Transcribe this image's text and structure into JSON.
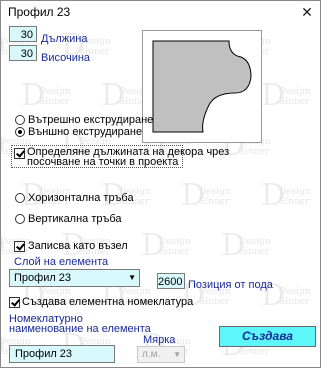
{
  "window": {
    "title": "Профил 23",
    "close_glyph": "✕"
  },
  "watermark": {
    "letter": "D",
    "word1": "Design",
    "word2": "Sinner"
  },
  "dimensions": {
    "length": {
      "value": "30",
      "label": "Дължина"
    },
    "height": {
      "value": "30",
      "label": "Височина"
    }
  },
  "extrusion": {
    "inner_label": "Вътрешно екструдиране",
    "outer_label": "Външно екструдиране",
    "selected": "outer"
  },
  "length_by_points": {
    "label_line1": "Определяне дължината на декора чрез",
    "label_line2": "посочване на точки в проекта",
    "checked": true
  },
  "pipes": {
    "horizontal_label": "Хоризонтална тръба",
    "vertical_label": "Вертикална тръба"
  },
  "save_as_node": {
    "label": "Записва като възел",
    "checked": true
  },
  "layer": {
    "label": "Слой на елемента",
    "selected": "Профил 23"
  },
  "floor_position": {
    "value": "2600",
    "label": "Позиция от пода"
  },
  "element_nomenclature": {
    "label": "Създава елементна номеклатура",
    "checked": true
  },
  "nomenclature_name": {
    "label_line1": "Номеклатурно",
    "label_line2": "наименование на елемента",
    "value": "Профил 23"
  },
  "unit": {
    "label": "Мярка",
    "value": "л.м."
  },
  "create_button": {
    "label": "Създава"
  },
  "colors": {
    "field_bg": "#d8f8fc",
    "button_bg": "#5cf6fb",
    "label_blue": "#1a2a9a",
    "preview_fill": "#c0c0c0"
  }
}
